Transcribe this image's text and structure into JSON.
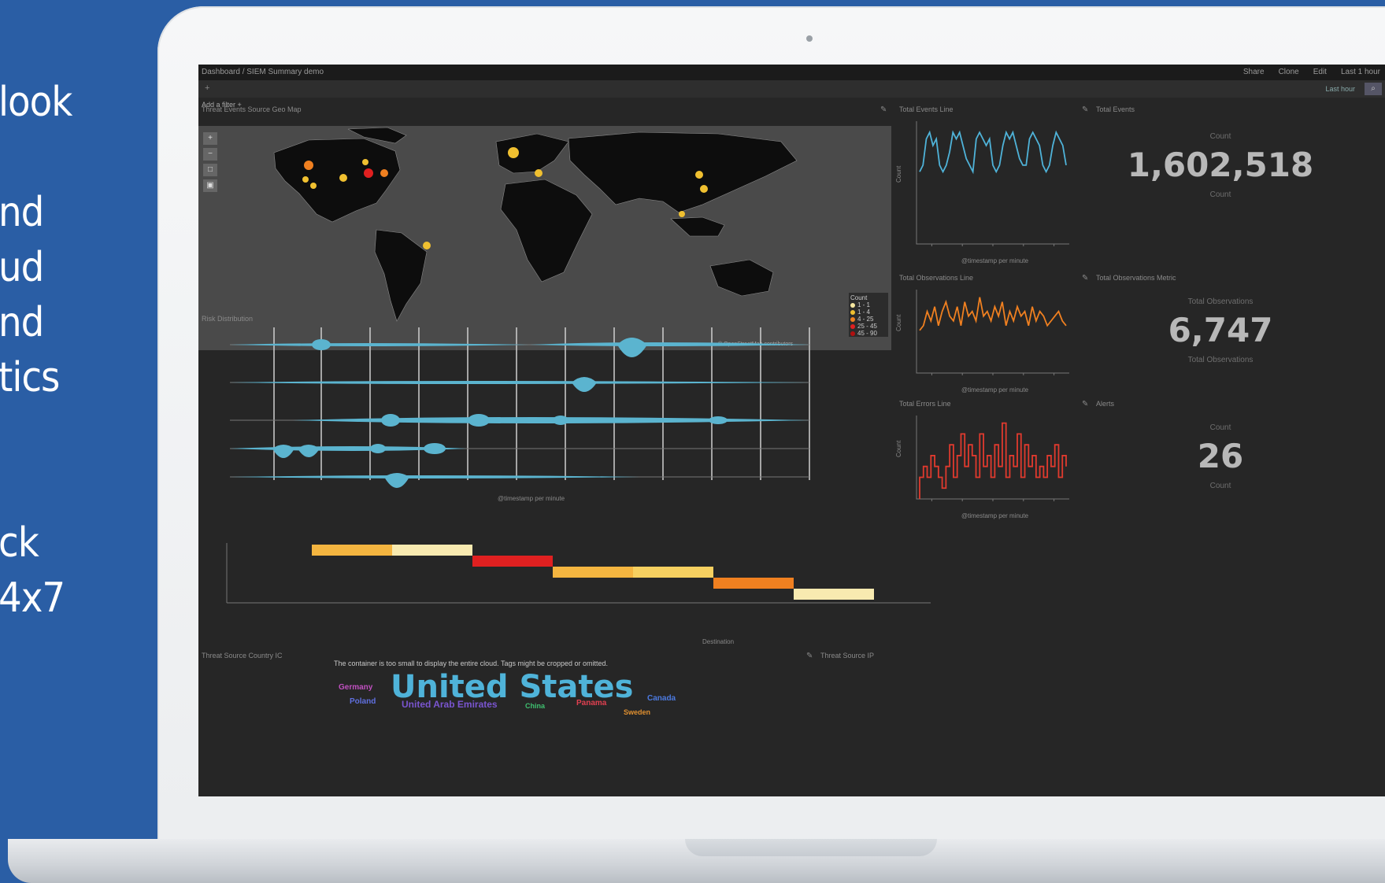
{
  "side_text": {
    "lines": [
      "look",
      "nd",
      "ud",
      "nd",
      "tics",
      "ck",
      "4x7"
    ]
  },
  "dashboard": {
    "breadcrumb": "Dashboard / SIEM Summary demo",
    "menu": [
      "Share",
      "Clone",
      "Edit",
      "Last 1 hour"
    ],
    "query": "Last hour",
    "filter_label": "Add a filter +",
    "panels": {
      "map_title": "Threat Events Source Geo Map",
      "map_credit": "© OpenStreetMap contributors",
      "map_legend_title": "Count",
      "map_legend": [
        "1 - 1",
        "1 - 4",
        "4 - 25",
        "25 - 45",
        "45 - 90"
      ],
      "timelion_title": "Risk Distribution",
      "timelion_xlabel": "@timestamp per minute",
      "heatmap_title": "",
      "heatmap_xlabel": "Destination",
      "events_line_title": "Total Events Line",
      "events_line_xlabel": "@timestamp per minute",
      "total_events_title": "Total Events",
      "obs_line_title": "Total Observations Line",
      "obs_line_xlabel": "@timestamp per minute",
      "total_obs_title": "Total Observations Metric",
      "errors_line_title": "Total Errors Line",
      "errors_line_xlabel": "@timestamp per minute",
      "alerts_title": "Alerts",
      "wordcloud_title": "Threat Source Country IC",
      "wordcloud_note": "The container is too small to display the entire cloud. Tags might be cropped or omitted.",
      "source_ip_title": "Threat Source IP"
    },
    "stats": [
      {
        "label": "Count",
        "value": "1,602,518",
        "sublabel": "Count"
      },
      {
        "label": "Total Observations",
        "value": "6,747",
        "sublabel": "Total Observations"
      },
      {
        "label": "Count",
        "value": "26",
        "sublabel": "Count"
      }
    ],
    "wordcloud": [
      {
        "word": "United States",
        "color": "#4fb3d9",
        "weight": "primary"
      },
      {
        "word": "Germany",
        "color": "#c050c0"
      },
      {
        "word": "Poland",
        "color": "#6070e0"
      },
      {
        "word": "United Arab Emirates",
        "color": "#7a55d0"
      },
      {
        "word": "China",
        "color": "#3fc070"
      },
      {
        "word": "Panama",
        "color": "#e04050"
      },
      {
        "word": "Canada",
        "color": "#4c7ae0"
      },
      {
        "word": "Sweden",
        "color": "#e09030"
      }
    ],
    "colors": {
      "background": "#2a5ea5",
      "screen": "#262626",
      "events_series": "#4fb3d9",
      "obs_series": "#f08020",
      "errors_series": "#e03a2e"
    }
  },
  "chart_data": [
    {
      "type": "line",
      "title": "Total Events Line",
      "xlabel": "@timestamp per minute",
      "ylabel": "Count",
      "series": [
        {
          "values": [
            11,
            12,
            16,
            17,
            15,
            16,
            12,
            11,
            12,
            14,
            17,
            16,
            17,
            15,
            13,
            12,
            11,
            16,
            17,
            16,
            15,
            16,
            12,
            11,
            12,
            15,
            17,
            16,
            17,
            15,
            13,
            12,
            12,
            16,
            17,
            16,
            15,
            12,
            11,
            12,
            15,
            17,
            16,
            15,
            12
          ]
        }
      ]
    },
    {
      "type": "line",
      "title": "Total Observations Line",
      "xlabel": "@timestamp per minute",
      "ylabel": "Count",
      "series": [
        {
          "values": [
            9,
            10,
            13,
            11,
            14,
            10,
            13,
            15,
            12,
            11,
            14,
            10,
            15,
            12,
            13,
            11,
            16,
            12,
            13,
            11,
            14,
            12,
            15,
            10,
            13,
            11,
            14,
            12,
            13,
            10,
            14,
            11,
            13,
            12,
            10,
            11,
            12,
            13,
            11,
            10
          ]
        }
      ]
    },
    {
      "type": "line",
      "title": "Total Errors Line",
      "xlabel": "@timestamp per minute",
      "ylabel": "Count",
      "series": [
        {
          "values": [
            2,
            3,
            2,
            4,
            3,
            2,
            1,
            3,
            5,
            2,
            4,
            6,
            3,
            5,
            4,
            2,
            6,
            3,
            4,
            2,
            5,
            3,
            7,
            2,
            4,
            3,
            6,
            2,
            5,
            3,
            4,
            2,
            3,
            2,
            4,
            3,
            5,
            2,
            4,
            3
          ]
        }
      ]
    },
    {
      "type": "heatmap",
      "title": "",
      "xlabel": "Destination",
      "cells": [
        {
          "col": 0,
          "row": 0,
          "level": 3
        },
        {
          "col": 1,
          "row": 0,
          "level": 1
        },
        {
          "col": 2,
          "row": 1,
          "level": 5
        },
        {
          "col": 3,
          "row": 2,
          "level": 3
        },
        {
          "col": 4,
          "row": 2,
          "level": 2
        },
        {
          "col": 5,
          "row": 3,
          "level": 4
        },
        {
          "col": 6,
          "row": 4,
          "level": 1
        }
      ]
    }
  ]
}
